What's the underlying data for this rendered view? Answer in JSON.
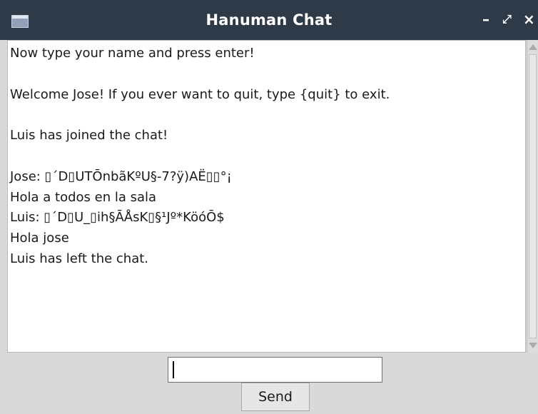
{
  "window": {
    "title": "Hanuman Chat",
    "controls": {
      "minimize": "–",
      "maximize": "⤢",
      "close": "×"
    },
    "titlebar_color": "#2f3a49"
  },
  "chat": {
    "lines": [
      "Now type your name and press enter!",
      "",
      "Welcome Jose! If you ever want to quit, type {quit} to exit.",
      "",
      "Luis has joined the chat!",
      "",
      "Jose: ▯´D▯UTŌnbãKºU§-7?ÿ)AË▯▯°¡",
      "Hola a todos en la sala",
      "Luis: ▯´D▯U_▯ih§ĀÅsK▯§¹Jº*KöóŌ$",
      "Hola jose",
      "Luis has left the chat."
    ]
  },
  "input": {
    "value": ""
  },
  "send_button": {
    "label": "Send"
  }
}
